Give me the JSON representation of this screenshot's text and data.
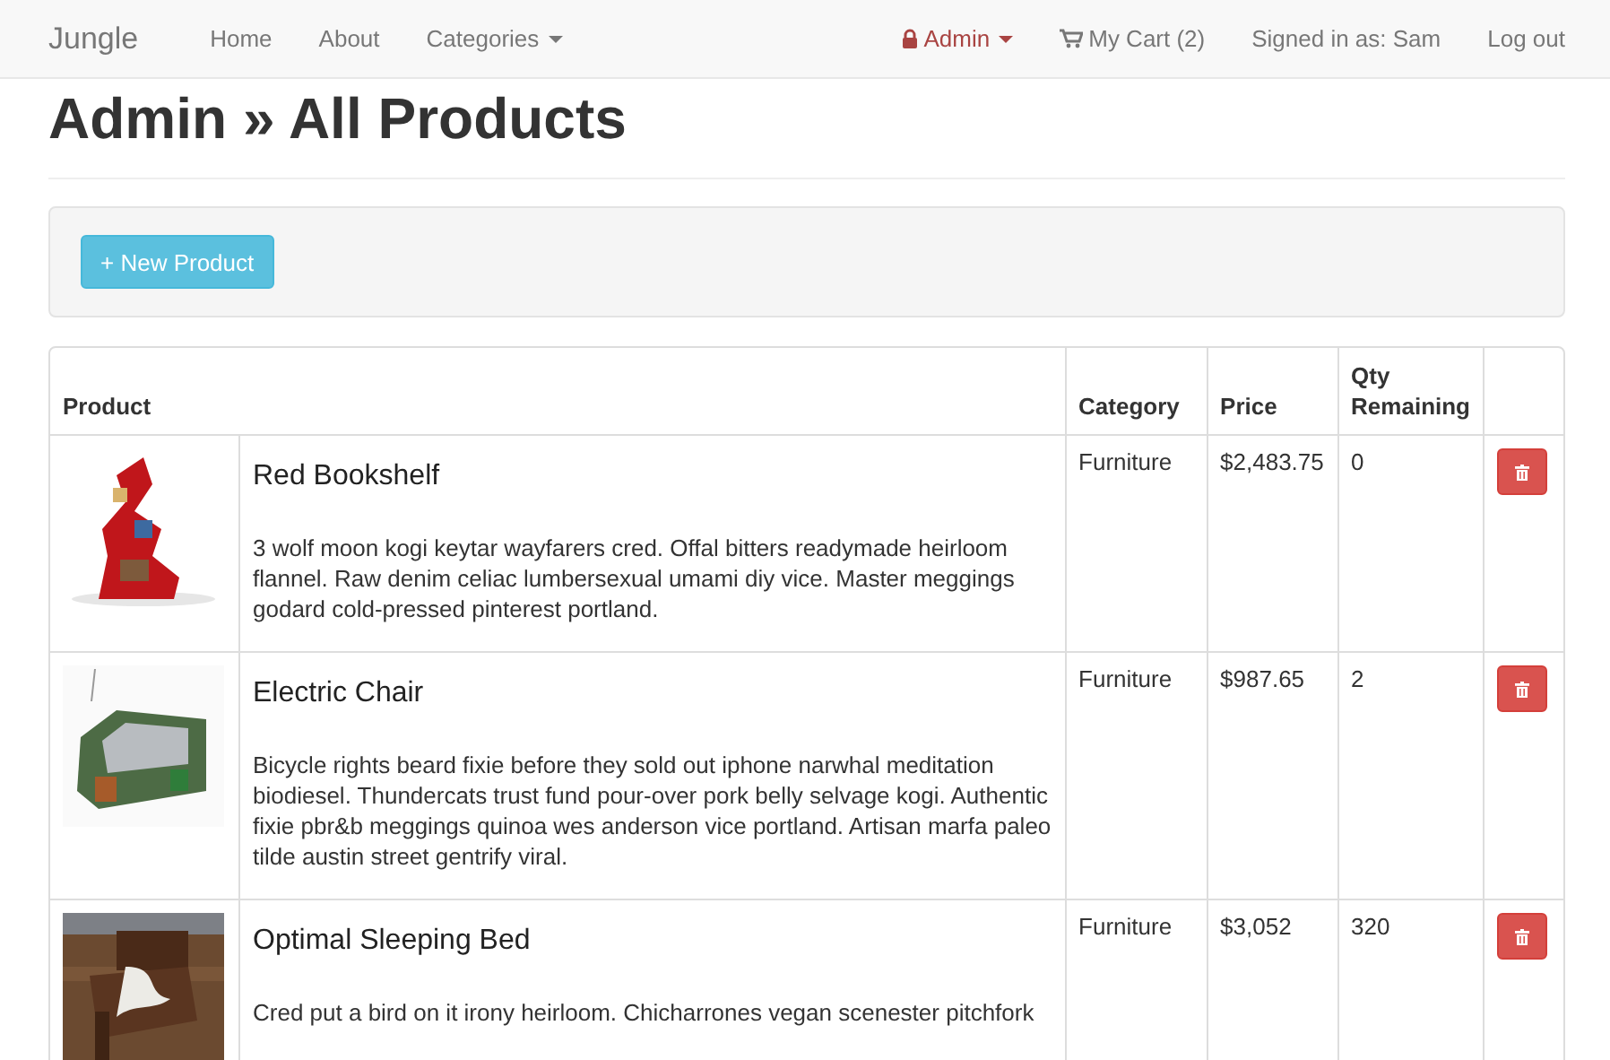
{
  "navbar": {
    "brand": "Jungle",
    "left_links": [
      "Home",
      "About"
    ],
    "categories": {
      "label": "Categories"
    },
    "admin": {
      "label": "Admin"
    },
    "cart": {
      "label": "My Cart (2)"
    },
    "signed_in": "Signed in as: Sam",
    "logout": "Log out"
  },
  "heading": "Admin » All Products",
  "new_button": "+ New Product",
  "table": {
    "columns": [
      "Product",
      "Category",
      "Price",
      "Qty Remaining"
    ],
    "rows": [
      {
        "name": "Red Bookshelf",
        "description": "3 wolf moon kogi keytar wayfarers cred. Offal bitters readymade heirloom flannel. Raw denim celiac lumbersexual umami diy vice. Master meggings godard cold-pressed pinterest portland.",
        "category": "Furniture",
        "price": "$2,483.75",
        "qty": "0"
      },
      {
        "name": "Electric Chair",
        "description": "Bicycle rights beard fixie before they sold out iphone narwhal meditation biodiesel. Thundercats trust fund pour-over pork belly selvage kogi. Authentic fixie pbr&b meggings quinoa wes anderson vice portland. Artisan marfa paleo tilde austin street gentrify viral.",
        "category": "Furniture",
        "price": "$987.65",
        "qty": "2"
      },
      {
        "name": "Optimal Sleeping Bed",
        "description": "Cred put a bird on it irony heirloom. Chicharrones vegan scenester pitchfork",
        "category": "Furniture",
        "price": "$3,052",
        "qty": "320"
      }
    ]
  }
}
